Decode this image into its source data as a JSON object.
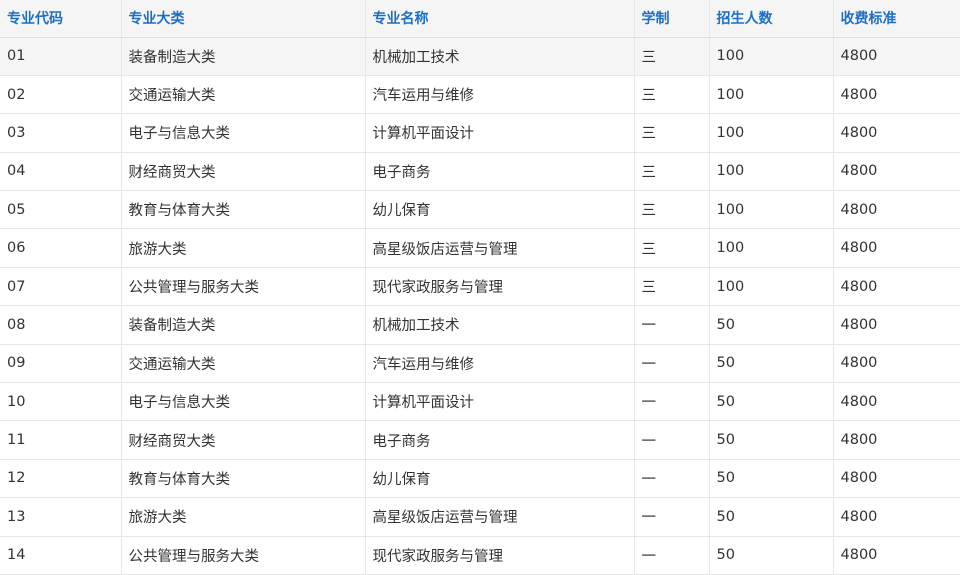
{
  "table": {
    "headers": [
      "专业代码",
      "专业大类",
      "专业名称",
      "学制",
      "招生人数",
      "收费标准"
    ],
    "rows": [
      [
        "01",
        "装备制造大类",
        "机械加工技术",
        "三",
        "100",
        "4800"
      ],
      [
        "02",
        "交通运输大类",
        "汽车运用与维修",
        "三",
        "100",
        "4800"
      ],
      [
        "03",
        "电子与信息大类",
        "计算机平面设计",
        "三",
        "100",
        "4800"
      ],
      [
        "04",
        "财经商贸大类",
        "电子商务",
        "三",
        "100",
        "4800"
      ],
      [
        "05",
        "教育与体育大类",
        "幼儿保育",
        "三",
        "100",
        "4800"
      ],
      [
        "06",
        "旅游大类",
        "高星级饭店运营与管理",
        "三",
        "100",
        "4800"
      ],
      [
        "07",
        "公共管理与服务大类",
        "现代家政服务与管理",
        "三",
        "100",
        "4800"
      ],
      [
        "08",
        "装备制造大类",
        "机械加工技术",
        "一",
        "50",
        "4800"
      ],
      [
        "09",
        "交通运输大类",
        "汽车运用与维修",
        "一",
        "50",
        "4800"
      ],
      [
        "10",
        "电子与信息大类",
        "计算机平面设计",
        "一",
        "50",
        "4800"
      ],
      [
        "11",
        "财经商贸大类",
        "电子商务",
        "一",
        "50",
        "4800"
      ],
      [
        "12",
        "教育与体育大类",
        "幼儿保育",
        "一",
        "50",
        "4800"
      ],
      [
        "13",
        "旅游大类",
        "高星级饭店运营与管理",
        "一",
        "50",
        "4800"
      ],
      [
        "14",
        "公共管理与服务大类",
        "现代家政服务与管理",
        "一",
        "50",
        "4800"
      ]
    ]
  },
  "colors": {
    "header_text": "#1f6fc0",
    "header_bg": "#f5f5f5",
    "border": "#e6e6e6",
    "body_text": "#333333"
  }
}
